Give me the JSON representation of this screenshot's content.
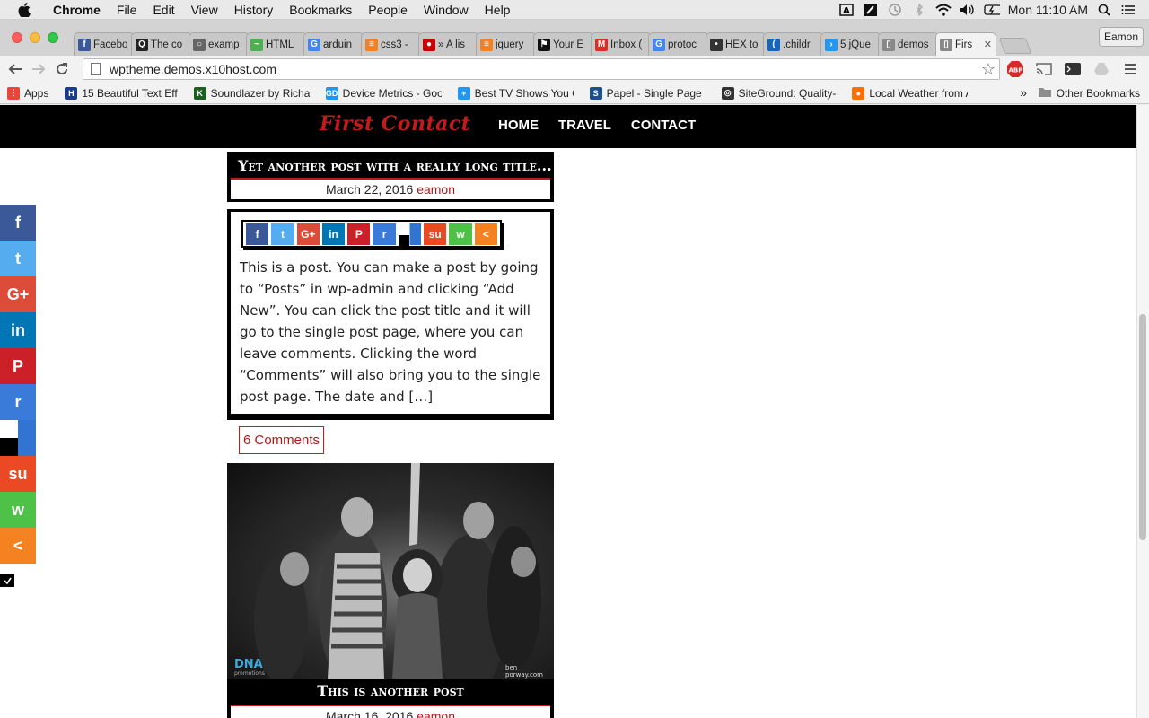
{
  "menubar": {
    "app": "Chrome",
    "items": [
      "File",
      "Edit",
      "View",
      "History",
      "Bookmarks",
      "People",
      "Window",
      "Help"
    ],
    "clock": "Mon 11:10 AM"
  },
  "tabs": [
    {
      "label": "Facebo",
      "color": "#3b5998",
      "glyph": "f"
    },
    {
      "label": "The co",
      "color": "#222222",
      "glyph": "Q"
    },
    {
      "label": "examp",
      "color": "#666666",
      "glyph": "○"
    },
    {
      "label": "HTML",
      "color": "#4caf50",
      "glyph": "~"
    },
    {
      "label": "arduin",
      "color": "#4285f4",
      "glyph": "G"
    },
    {
      "label": "css3 -",
      "color": "#f48024",
      "glyph": "≡"
    },
    {
      "label": "» A lis",
      "color": "#cc0000",
      "glyph": "●"
    },
    {
      "label": "jquery",
      "color": "#f48024",
      "glyph": "≡"
    },
    {
      "label": "Your E",
      "color": "#111111",
      "glyph": "⚑"
    },
    {
      "label": "Inbox (",
      "color": "#d93025",
      "glyph": "M"
    },
    {
      "label": "protoc",
      "color": "#4285f4",
      "glyph": "G"
    },
    {
      "label": "HEX to",
      "color": "#333333",
      "glyph": "•"
    },
    {
      "label": ".childr",
      "color": "#1565c0",
      "glyph": "("
    },
    {
      "label": "5 jQue",
      "color": "#2196f3",
      "glyph": "›"
    },
    {
      "label": "demos",
      "color": "#888888",
      "glyph": "▯"
    },
    {
      "label": "Firs",
      "color": "#888888",
      "glyph": "▯",
      "active": true
    }
  ],
  "profile": "Eamon",
  "url": "wptheme.demos.x10host.com",
  "bookmarks": [
    {
      "label": "Apps",
      "color": "#e8453c",
      "glyph": "⋮"
    },
    {
      "label": "15 Beautiful Text Eff",
      "color": "#1a3a8a",
      "glyph": "H"
    },
    {
      "label": "Soundlazer by Richar",
      "color": "#1b5e20",
      "glyph": "K"
    },
    {
      "label": "Device Metrics - Goo",
      "color": "#2196f3",
      "glyph": "GD"
    },
    {
      "label": "Best TV Shows You C",
      "color": "#2196f3",
      "glyph": "+"
    },
    {
      "label": "Papel - Single Page F",
      "color": "#1e4e8c",
      "glyph": "S"
    },
    {
      "label": "SiteGround: Quality-",
      "color": "#333333",
      "glyph": "◎"
    },
    {
      "label": "Local Weather from A",
      "color": "#ff6f00",
      "glyph": "●"
    }
  ],
  "other_bookmarks": "Other Bookmarks",
  "site": {
    "logo": "First Contact",
    "nav": [
      "HOME",
      "TRAVEL",
      "CONTACT"
    ]
  },
  "post1": {
    "title": "Yet another post with a really long title...",
    "date": "March 22, 2016",
    "author": "eamon",
    "excerpt": "This is a post. You can make a post by going to “Posts” in wp-admin and clicking “Add New”. You can click the post title and it will go to the single post page, where you can leave comments. Clicking the word “Comments” will also bring you to the single post page. The date and […]",
    "comments": "6 Comments"
  },
  "post2": {
    "title": "This is another post",
    "date": "March 16, 2016",
    "author": "eamon",
    "photo_credit_left": "DNA promotions",
    "photo_credit_right": "ben porway.com"
  },
  "share_buttons": [
    {
      "name": "facebook",
      "glyph": "f",
      "color": "#3b5998"
    },
    {
      "name": "twitter",
      "glyph": "t",
      "color": "#55acee"
    },
    {
      "name": "google-plus",
      "glyph": "G+",
      "color": "#dd4b39"
    },
    {
      "name": "linkedin",
      "glyph": "in",
      "color": "#0077b5"
    },
    {
      "name": "pinterest",
      "glyph": "P",
      "color": "#cb2027"
    },
    {
      "name": "reddit",
      "glyph": "r",
      "color": "#3a7ad8"
    },
    {
      "name": "delicious",
      "glyph": "",
      "color": "#ffffff"
    },
    {
      "name": "stumbleupon",
      "glyph": "su",
      "color": "#eb4924"
    },
    {
      "name": "whatsapp",
      "glyph": "w",
      "color": "#4dc247"
    },
    {
      "name": "more",
      "glyph": "<",
      "color": "#f58220"
    }
  ]
}
